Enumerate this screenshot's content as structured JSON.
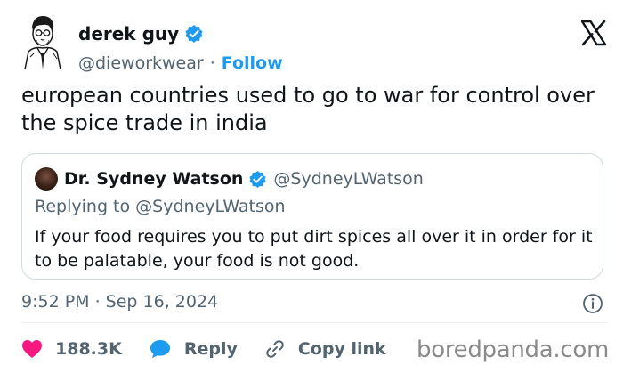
{
  "author": {
    "name": "derek guy",
    "handle": "@dieworkwear",
    "separator": "·",
    "follow_label": "Follow"
  },
  "tweet": {
    "text": "european countries used to go to war for control over the spice trade in india"
  },
  "quoted": {
    "name": "Dr. Sydney Watson",
    "handle": "@SydneyLWatson",
    "replying_to": "Replying to @SydneyLWatson",
    "text": "If your food requires you to put dirt spices all over it in order for it to be palatable, your food is not good."
  },
  "meta": {
    "timestamp": "9:52 PM · Sep 16, 2024"
  },
  "actions": {
    "likes": "188.3K",
    "reply_label": "Reply",
    "copy_link_label": "Copy link"
  },
  "watermark": "boredpanda.com",
  "colors": {
    "accent": "#1d9bf0",
    "like": "#f91880",
    "secondary_text": "#536471",
    "border": "#cfd9de"
  },
  "icons": [
    "portrait-avatar",
    "verified-badge-icon",
    "x-logo-icon",
    "info-icon",
    "heart-icon",
    "reply-bubble-icon",
    "link-icon"
  ]
}
